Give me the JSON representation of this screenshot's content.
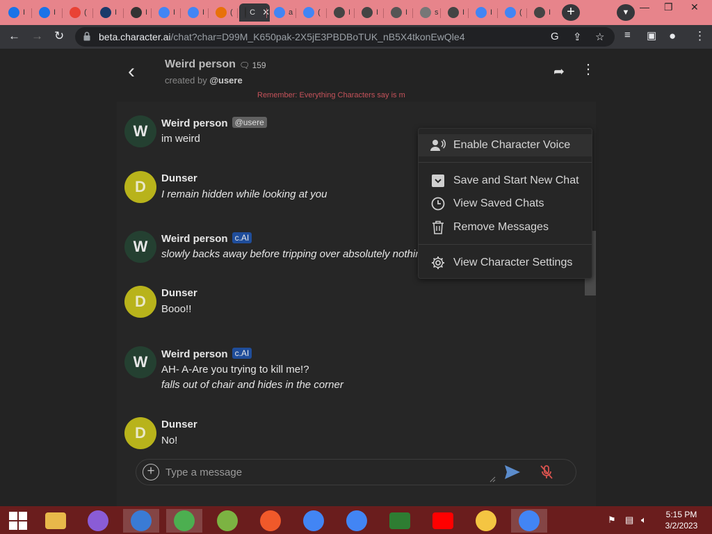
{
  "browser": {
    "tabs": [
      {
        "icon": "m-icon",
        "letter": "I",
        "color": "#1a73e8"
      },
      {
        "icon": "m-icon",
        "letter": "I",
        "color": "#1a73e8"
      },
      {
        "icon": "chrome-icon",
        "letter": "(",
        "color": "#e94235"
      },
      {
        "icon": "bg-icon",
        "letter": "I",
        "color": "#1a3a6a"
      },
      {
        "icon": "download-icon",
        "letter": "I",
        "color": "#333"
      },
      {
        "icon": "google-icon",
        "letter": "I",
        "color": "#4285f4"
      },
      {
        "icon": "google-icon",
        "letter": "I",
        "color": "#4285f4"
      },
      {
        "icon": "pencil-icon",
        "letter": "(",
        "color": "#e8710a"
      },
      {
        "icon": "characterai-icon",
        "letter": "C",
        "color": "#2b2b2b",
        "active": true
      },
      {
        "icon": "google-icon",
        "letter": "a",
        "color": "#4285f4"
      },
      {
        "icon": "google-icon",
        "letter": "(",
        "color": "#4285f4"
      },
      {
        "icon": "gear-icon",
        "letter": "I",
        "color": "#444"
      },
      {
        "icon": "globe-icon",
        "letter": "I",
        "color": "#444"
      },
      {
        "icon": "chrome-icon",
        "letter": "I",
        "color": "#555"
      },
      {
        "icon": "globe-icon",
        "letter": "s",
        "color": "#777"
      },
      {
        "icon": "globe-icon",
        "letter": "I",
        "color": "#444"
      },
      {
        "icon": "google-icon",
        "letter": "I",
        "color": "#4285f4"
      },
      {
        "icon": "google-icon",
        "letter": "(",
        "color": "#4285f4"
      },
      {
        "icon": "globe-icon",
        "letter": "I",
        "color": "#444"
      }
    ],
    "new_tab": "+",
    "url_domain": "beta.character.ai",
    "url_path": "/chat?char=D99M_K650pak-2X5jE3PBDBoTUK_nB5X4tkonEwQle4"
  },
  "header": {
    "character_name": "Weird person",
    "chat_count": "159",
    "created_by_prefix": "created by",
    "created_by_user": "@usere",
    "reminder": "Remember: Everything Characters say is m"
  },
  "messages": [
    {
      "author": "Weird person",
      "avatar_letter": "W",
      "kind": "char",
      "badge": "@usere",
      "badge_type": "user",
      "lines": [
        {
          "text": "im weird",
          "italic": false
        }
      ]
    },
    {
      "author": "Dunser",
      "avatar_letter": "D",
      "kind": "user",
      "badge": "",
      "badge_type": "",
      "lines": [
        {
          "text": "I remain hidden while looking at you",
          "italic": true
        }
      ]
    },
    {
      "author": "Weird person",
      "avatar_letter": "W",
      "kind": "char",
      "badge": "c.AI",
      "badge_type": "cai",
      "lines": [
        {
          "text": "slowly backs away before tripping over absolutely nothing",
          "italic": true
        }
      ]
    },
    {
      "author": "Dunser",
      "avatar_letter": "D",
      "kind": "user",
      "badge": "",
      "badge_type": "",
      "lines": [
        {
          "text": "Booo!!",
          "italic": false
        }
      ]
    },
    {
      "author": "Weird person",
      "avatar_letter": "W",
      "kind": "char",
      "badge": "c.AI",
      "badge_type": "cai",
      "lines": [
        {
          "text": "AH- A-Are you trying to kill me!?",
          "italic": false
        },
        {
          "text": "falls out of chair and hides in the corner",
          "italic": true
        }
      ]
    },
    {
      "author": "Dunser",
      "avatar_letter": "D",
      "kind": "user",
      "badge": "",
      "badge_type": "",
      "lines": [
        {
          "text": "No!",
          "italic": false
        }
      ]
    }
  ],
  "composer": {
    "placeholder": "Type a message"
  },
  "menu": {
    "items": [
      {
        "label": "Enable Character Voice",
        "icon": "voice-icon"
      },
      {
        "label": "Save and Start New Chat",
        "icon": "save-icon"
      },
      {
        "label": "View Saved Chats",
        "icon": "history-icon"
      },
      {
        "label": "Remove Messages",
        "icon": "trash-icon"
      },
      {
        "label": "View Character Settings",
        "icon": "gear-icon"
      }
    ]
  },
  "taskbar": {
    "items": [
      "start-icon",
      "file-explorer-icon",
      "visual-studio-icon",
      "tools-icon",
      "chrome-icon",
      "coccoc-icon",
      "brave-icon",
      "chrome-profile-icon",
      "chrome-profile-icon",
      "terminal-icon",
      "youtube-icon",
      "paint-icon",
      "chrome-profile-icon"
    ],
    "time": "5:15 PM",
    "date": "3/2/2023"
  }
}
